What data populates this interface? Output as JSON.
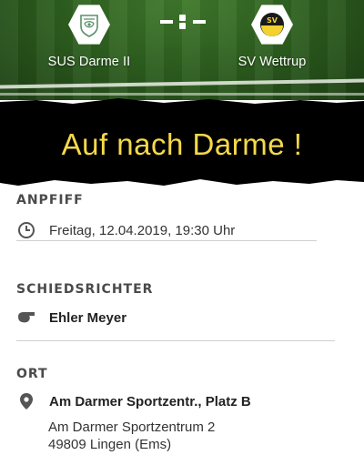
{
  "match": {
    "home_team": "SUS Darme II",
    "away_team": "SV Wettrup",
    "away_badge_text": "SV"
  },
  "banner": {
    "title": "Auf nach Darme !",
    "color": "#f5d94a"
  },
  "kickoff": {
    "heading": "ANPFIFF",
    "icon": "clock-icon",
    "datetime": "Freitag, 12.04.2019, 19:30 Uhr"
  },
  "referee": {
    "heading": "SCHIEDSRICHTER",
    "icon": "whistle-icon",
    "name": "Ehler Meyer"
  },
  "location": {
    "heading": "ORT",
    "icon": "location-pin-icon",
    "venue": "Am Darmer Sportzentr., Platz B",
    "street": "Am Darmer Sportzentrum 2",
    "city": "49809 Lingen (Ems)"
  }
}
